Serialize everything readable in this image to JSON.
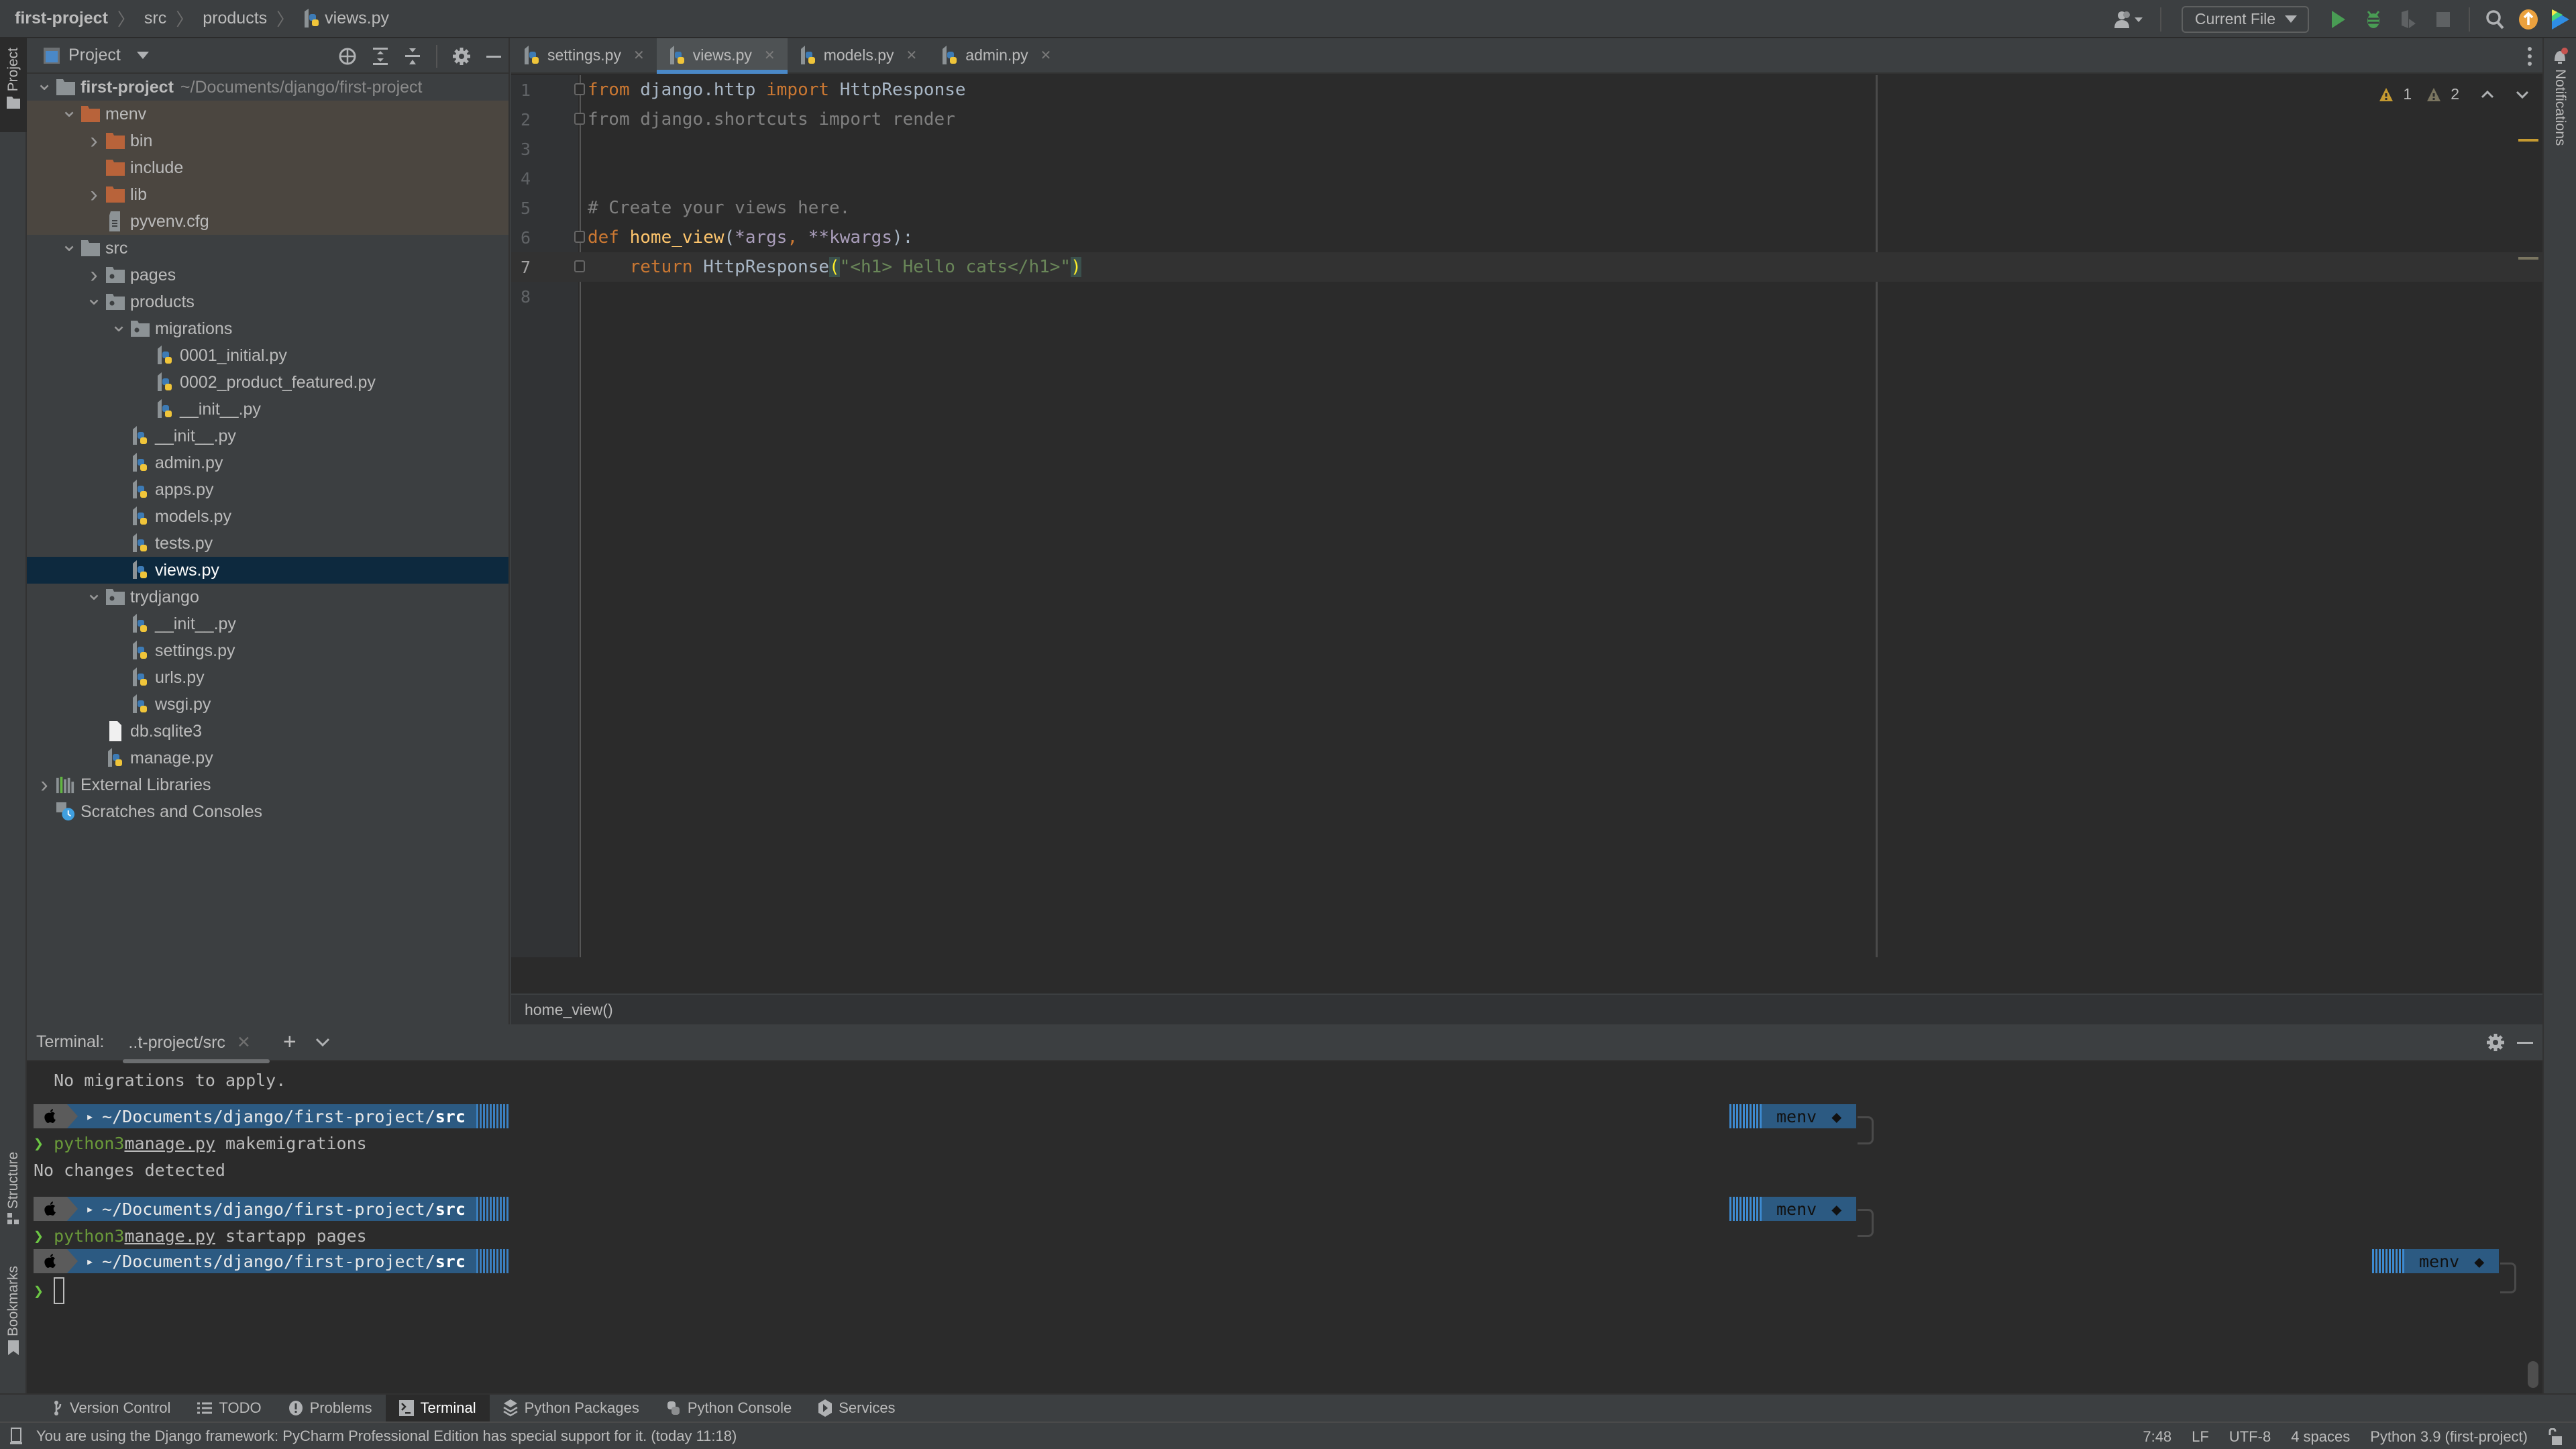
{
  "breadcrumb": [
    "first-project",
    "src",
    "products",
    "views.py"
  ],
  "toolbar": {
    "run_config": "Current File",
    "icons": [
      "account-icon",
      "run-icon",
      "debug-icon",
      "coverage-icon",
      "stop-icon",
      "search-icon",
      "update-icon",
      "toolbox-icon"
    ]
  },
  "left_strip": {
    "project": "Project",
    "structure": "Structure",
    "bookmarks": "Bookmarks"
  },
  "right_strip": {
    "notifications": "Notifications"
  },
  "project_panel": {
    "title": "Project",
    "tree": [
      {
        "label": "first-project",
        "path": "~/Documents/django/first-project",
        "depth": 0,
        "expanded": true,
        "type": "root"
      },
      {
        "label": "menv",
        "depth": 1,
        "expanded": true,
        "type": "excluded-folder"
      },
      {
        "label": "bin",
        "depth": 2,
        "expanded": false,
        "type": "excluded-folder"
      },
      {
        "label": "include",
        "depth": 2,
        "type": "excluded-folder-leaf"
      },
      {
        "label": "lib",
        "depth": 2,
        "expanded": false,
        "type": "excluded-folder"
      },
      {
        "label": "pyvenv.cfg",
        "depth": 2,
        "type": "text-file-excluded"
      },
      {
        "label": "src",
        "depth": 1,
        "expanded": true,
        "type": "folder"
      },
      {
        "label": "pages",
        "depth": 2,
        "expanded": false,
        "type": "package"
      },
      {
        "label": "products",
        "depth": 2,
        "expanded": true,
        "type": "package"
      },
      {
        "label": "migrations",
        "depth": 3,
        "expanded": true,
        "type": "package"
      },
      {
        "label": "0001_initial.py",
        "depth": 4,
        "type": "python"
      },
      {
        "label": "0002_product_featured.py",
        "depth": 4,
        "type": "python"
      },
      {
        "label": "__init__.py",
        "depth": 4,
        "type": "python"
      },
      {
        "label": "__init__.py",
        "depth": 3,
        "type": "python"
      },
      {
        "label": "admin.py",
        "depth": 3,
        "type": "python"
      },
      {
        "label": "apps.py",
        "depth": 3,
        "type": "python"
      },
      {
        "label": "models.py",
        "depth": 3,
        "type": "python"
      },
      {
        "label": "tests.py",
        "depth": 3,
        "type": "python"
      },
      {
        "label": "views.py",
        "depth": 3,
        "type": "python",
        "selected": true
      },
      {
        "label": "trydjango",
        "depth": 2,
        "expanded": true,
        "type": "package"
      },
      {
        "label": "__init__.py",
        "depth": 3,
        "type": "python"
      },
      {
        "label": "settings.py",
        "depth": 3,
        "type": "python"
      },
      {
        "label": "urls.py",
        "depth": 3,
        "type": "python"
      },
      {
        "label": "wsgi.py",
        "depth": 3,
        "type": "python"
      },
      {
        "label": "db.sqlite3",
        "depth": 2,
        "type": "file"
      },
      {
        "label": "manage.py",
        "depth": 2,
        "type": "python"
      },
      {
        "label": "External Libraries",
        "depth": 0,
        "expanded": false,
        "type": "libraries"
      },
      {
        "label": "Scratches and Consoles",
        "depth": 0,
        "type": "scratches"
      }
    ]
  },
  "editor": {
    "tabs": [
      {
        "label": "settings.py",
        "active": false
      },
      {
        "label": "views.py",
        "active": true
      },
      {
        "label": "models.py",
        "active": false
      },
      {
        "label": "admin.py",
        "active": false
      }
    ],
    "inspections": {
      "warnings": "1",
      "weak_warnings": "2"
    },
    "lines": [
      {
        "n": "1",
        "tokens": [
          [
            "kw",
            "from"
          ],
          [
            "id",
            " django.http "
          ],
          [
            "kw",
            "import"
          ],
          [
            "id",
            " HttpResponse"
          ]
        ]
      },
      {
        "n": "2",
        "tokens": [
          [
            "un",
            "from django.shortcuts import render"
          ]
        ]
      },
      {
        "n": "3",
        "tokens": []
      },
      {
        "n": "4",
        "tokens": []
      },
      {
        "n": "5",
        "tokens": [
          [
            "cm",
            "# Create your views here."
          ]
        ]
      },
      {
        "n": "6",
        "tokens": [
          [
            "kw",
            "def "
          ],
          [
            "fn",
            "home_view"
          ],
          [
            "id",
            "("
          ],
          [
            "pm",
            "*args"
          ],
          [
            "kw",
            ", "
          ],
          [
            "pm",
            "**kwargs"
          ],
          [
            "id",
            "):"
          ]
        ]
      },
      {
        "n": "7",
        "current": true,
        "tokens": [
          [
            "id",
            "    "
          ],
          [
            "kw",
            "return "
          ],
          [
            "id",
            "HttpResponse"
          ],
          [
            "br",
            "("
          ],
          [
            "st",
            "\"<h1> Hello cats</h1>\""
          ],
          [
            "br",
            ")"
          ]
        ]
      },
      {
        "n": "8",
        "tokens": []
      }
    ],
    "breadcrumb": "home_view()"
  },
  "terminal": {
    "label": "Terminal:",
    "tab": "..t-project/src",
    "lines": [
      {
        "type": "out",
        "text": "  No migrations to apply."
      },
      {
        "type": "prompt",
        "path_prefix": "~/Documents/django/first-project/",
        "path_bold": "src",
        "env": "menv"
      },
      {
        "type": "cmd",
        "cmd": "python3",
        "arg": "manage.py",
        "rest": " makemigrations"
      },
      {
        "type": "out",
        "text": "No changes detected"
      },
      {
        "type": "prompt",
        "path_prefix": "~/Documents/django/first-project/",
        "path_bold": "src",
        "env": "menv"
      },
      {
        "type": "cmd",
        "cmd": "python3",
        "arg": "manage.py",
        "rest": " startapp pages"
      },
      {
        "type": "prompt",
        "path_prefix": "~/Documents/django/first-project/",
        "path_bold": "src",
        "env": "menv"
      },
      {
        "type": "input"
      }
    ]
  },
  "tool_windows": [
    {
      "label": "Version Control",
      "icon": "branch-icon"
    },
    {
      "label": "TODO",
      "icon": "list-icon"
    },
    {
      "label": "Problems",
      "icon": "problems-icon"
    },
    {
      "label": "Terminal",
      "icon": "terminal-icon",
      "active": true
    },
    {
      "label": "Python Packages",
      "icon": "packages-icon"
    },
    {
      "label": "Python Console",
      "icon": "python-icon"
    },
    {
      "label": "Services",
      "icon": "services-icon"
    }
  ],
  "status_bar": {
    "message": "You are using the Django framework: PyCharm Professional Edition has special support for it. (today 11:18)",
    "position": "7:48",
    "line_sep": "LF",
    "encoding": "UTF-8",
    "indent": "4 spaces",
    "interpreter": "Python 3.9 (first-project)"
  },
  "colors": {
    "accent": "#4a88c7",
    "selection": "#0d293e",
    "excluded_bg": "#4b4640",
    "excluded_folder": "#b8633a",
    "prompt_blue": "#2c5a82"
  }
}
